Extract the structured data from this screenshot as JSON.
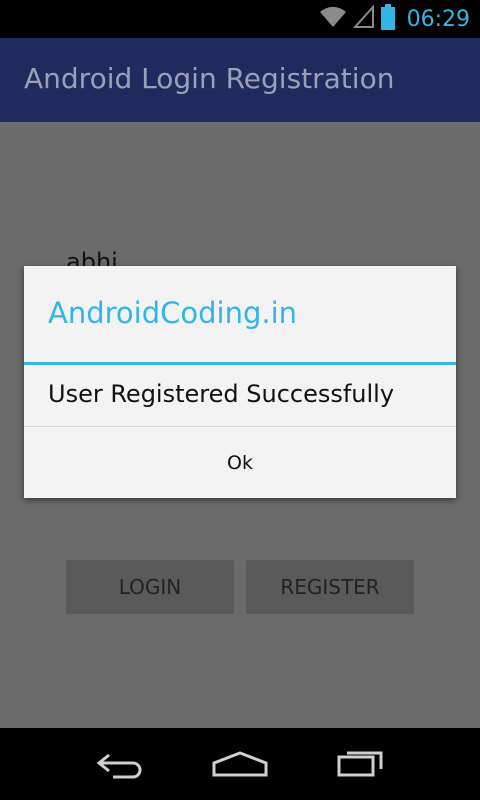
{
  "status_bar": {
    "time": "06:29",
    "icons": [
      "wifi-icon",
      "signal-icon",
      "battery-icon"
    ]
  },
  "app_bar": {
    "title": "Android Login Registration"
  },
  "form": {
    "username_value": "abhi",
    "login_label": "LOGIN",
    "register_label": "REGISTER"
  },
  "dialog": {
    "title": "AndroidCoding.in",
    "message": "User Registered Successfully",
    "ok_label": "Ok"
  },
  "nav_bar": {
    "icons": [
      "back-icon",
      "home-icon",
      "recents-icon"
    ]
  },
  "colors": {
    "accent": "#33b5e5",
    "action_bar": "#1f2a5e",
    "scrim_background": "#6b6b6b",
    "dialog_background": "#f3f3f3"
  }
}
